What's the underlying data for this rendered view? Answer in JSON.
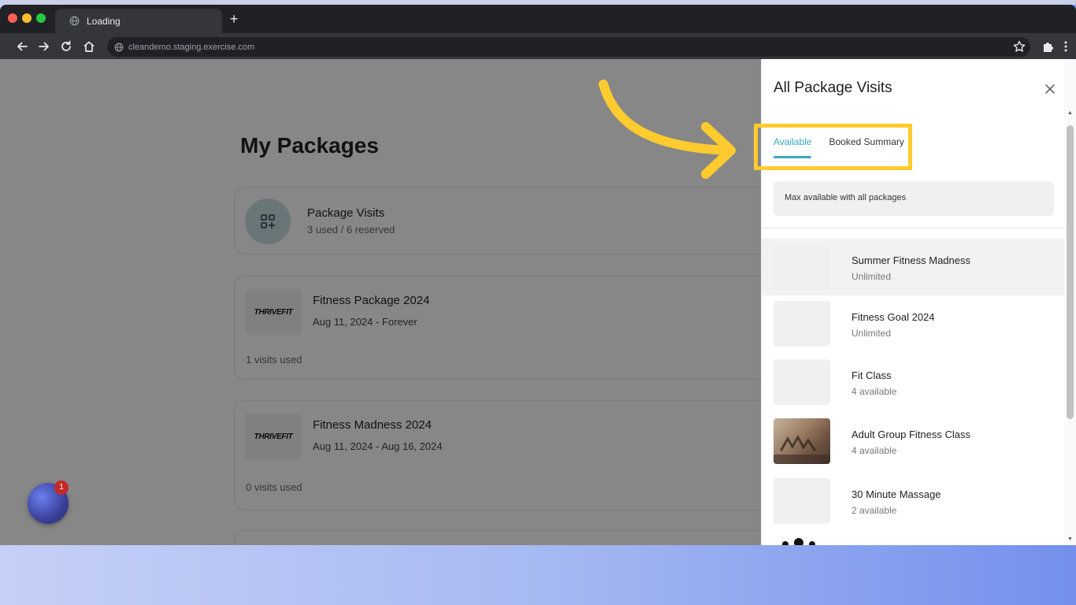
{
  "browser": {
    "tab_title": "Loading",
    "url": "cleandemo.staging.exercise.com"
  },
  "page": {
    "title": "My Packages",
    "visits_card": {
      "title": "Package Visits",
      "subtitle": "3 used / 6 reserved"
    },
    "packages": [
      {
        "logo": "THRIVEFIT",
        "title": "Fitness Package 2024",
        "dates": "Aug 11, 2024 - Forever",
        "used": "1 visits used"
      },
      {
        "logo": "THRIVEFIT",
        "title": "Fitness Madness 2024",
        "dates": "Aug 11, 2024 - Aug 16, 2024",
        "used": "0 visits used"
      }
    ],
    "chat_badge": "1"
  },
  "drawer": {
    "title": "All Package Visits",
    "tabs": {
      "available": "Available",
      "booked": "Booked Summary"
    },
    "max_info": "Max available with all packages",
    "items": [
      {
        "name": "Summer Fitness Madness",
        "availability": "Unlimited"
      },
      {
        "name": "Fitness Goal 2024",
        "availability": "Unlimited"
      },
      {
        "name": "Fit Class",
        "availability": "4 available"
      },
      {
        "name": "Adult Group Fitness Class",
        "availability": "4 available"
      },
      {
        "name": "30 Minute Massage",
        "availability": "2 available"
      }
    ]
  },
  "colors": {
    "accent": "#3aa6bf",
    "highlight": "#ffcb2e"
  }
}
